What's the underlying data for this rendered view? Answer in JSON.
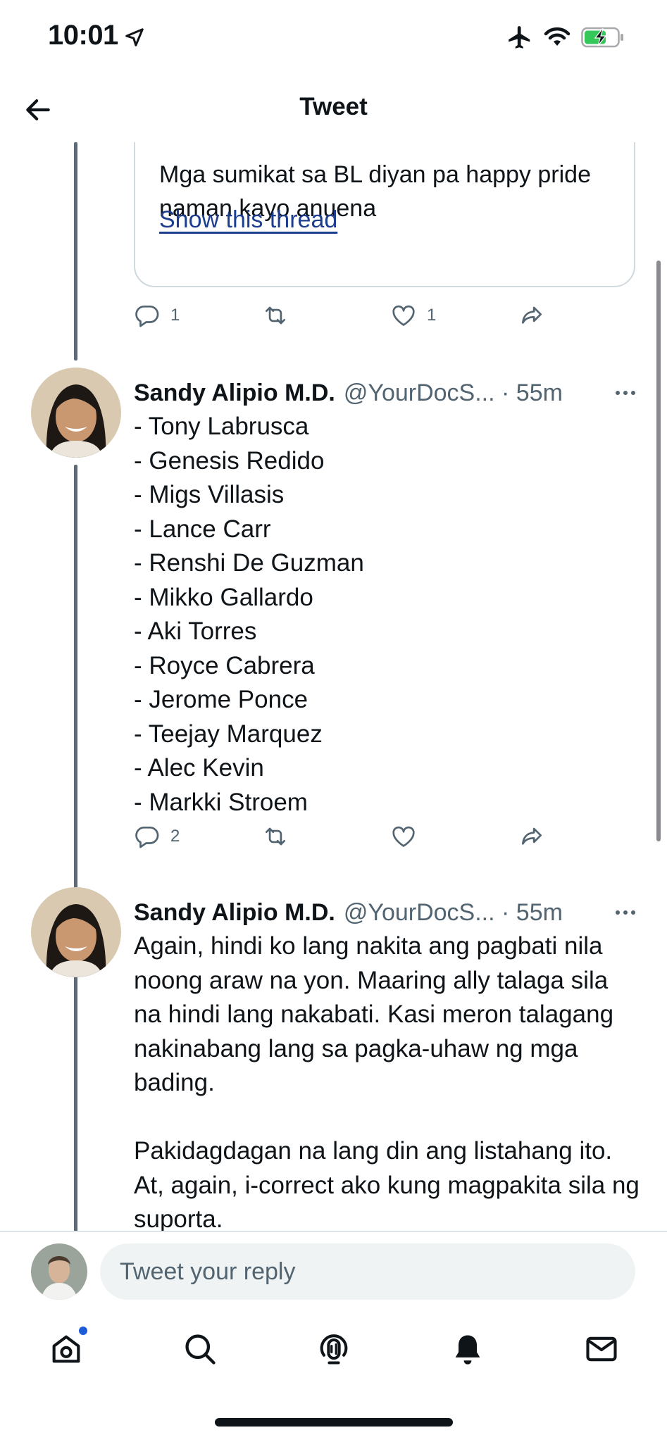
{
  "status_bar": {
    "time": "10:01",
    "icons": [
      "location-arrow-icon",
      "airplane-icon",
      "wifi-icon",
      "battery-charging-icon"
    ]
  },
  "nav": {
    "title": "Tweet",
    "back_icon": "arrow-left-icon"
  },
  "quoted_tweet": {
    "text": "Mga sumikat sa BL diyan pa happy pride naman kayo anuena",
    "link": "Show this thread",
    "actions": {
      "replies": "1",
      "retweets": "",
      "likes": "1"
    }
  },
  "tweets": [
    {
      "author": "Sandy Alipio M.D.",
      "handle_time": "@YourDocS... · 55m",
      "body": "- Tony Labrusca\n- Genesis Redido\n- Migs Villasis\n- Lance Carr\n- Renshi De Guzman\n- Mikko Gallardo\n- Aki Torres\n- Royce Cabrera\n- Jerome Ponce\n- Teejay Marquez\n- Alec Kevin\n- Markki Stroem",
      "actions": {
        "replies": "2",
        "retweets": "",
        "likes": ""
      }
    },
    {
      "author": "Sandy Alipio M.D.",
      "handle_time": "@YourDocS... · 55m",
      "body": "Again, hindi ko lang nakita ang pagbati nila noong araw na yon. Maaring ally talaga sila na hindi lang nakabati. Kasi meron talagang nakinabang lang sa pagka-uhaw ng mga bading.\n\nPakidagdagan na lang din ang listahang ito. At, again, i-correct ako kung magpakita sila ng suporta."
    }
  ],
  "reply": {
    "placeholder": "Tweet your reply"
  },
  "tab_bar": {
    "tabs": [
      "home-icon",
      "search-icon",
      "spaces-icon",
      "notifications-icon",
      "messages-icon"
    ],
    "home_has_badge": true
  },
  "colors": {
    "text": "#0f1419",
    "secondary": "#536471",
    "link": "#1d3d8f",
    "thread_line": "#5b6b7b",
    "border": "#cfd9de",
    "input_bg": "#eff3f4",
    "badge": "#1d5bd8",
    "battery_green": "#34c759"
  }
}
